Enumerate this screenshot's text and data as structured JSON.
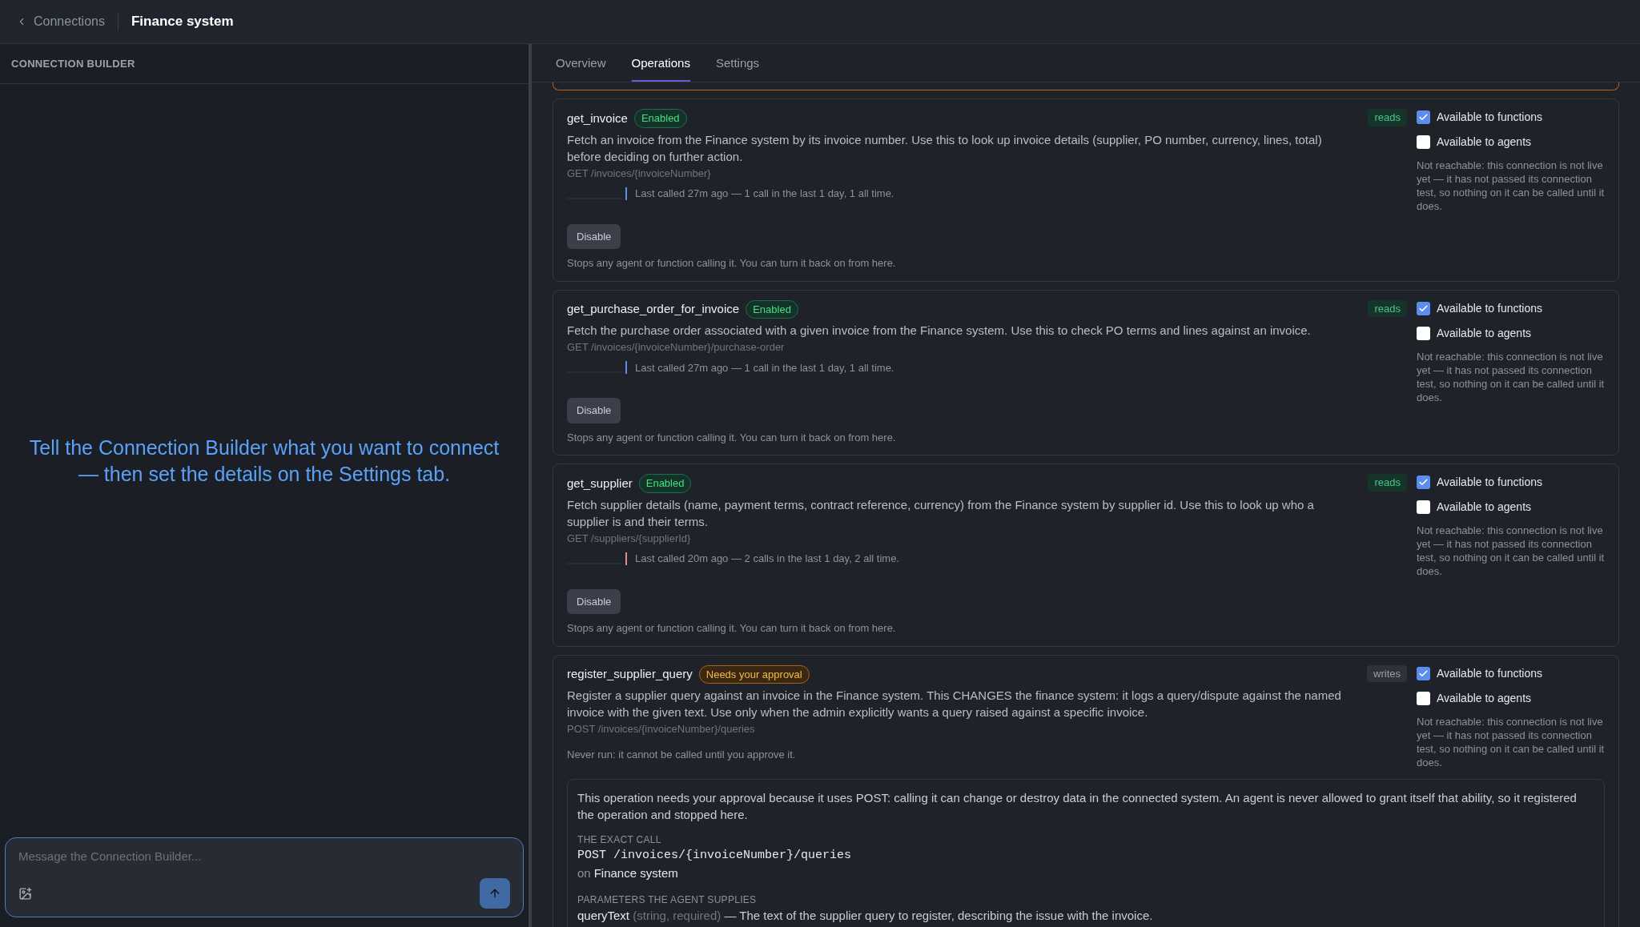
{
  "header": {
    "back_label": "Connections",
    "title": "Finance system"
  },
  "builder": {
    "title": "CONNECTION BUILDER",
    "prompt": "Tell the Connection Builder what you want to connect — then set the details on the Settings tab.",
    "input": {
      "placeholder": "Message the Connection Builder..."
    }
  },
  "tabs": [
    {
      "label": "Overview",
      "selected": false
    },
    {
      "label": "Operations",
      "selected": true
    },
    {
      "label": "Settings",
      "selected": false
    }
  ],
  "operations": [
    {
      "name": "get_invoice",
      "status": {
        "kind": "enabled",
        "label": "Enabled"
      },
      "access": {
        "kind": "reads",
        "label": "reads"
      },
      "description": "Fetch an invoice from the Finance system by its invoice number. Use this to look up invoice details (supplier, PO number, currency, lines, total) before deciding on further action.",
      "endpoint": "GET /invoices/{invoiceNumber}",
      "activity": {
        "text": "Last called 27m ago — 1 call in the last 1 day, 1 all time.",
        "color": "#5b8def"
      },
      "action": {
        "label": "Disable",
        "note": "Stops any agent or function calling it. You can turn it back on from here."
      },
      "availability": [
        {
          "label": "Available to functions",
          "checked": true
        },
        {
          "label": "Available to agents",
          "checked": false
        }
      ],
      "reach_note": "Not reachable: this connection is not live yet — it has not passed its connection test, so nothing on it can be called until it does."
    },
    {
      "name": "get_purchase_order_for_invoice",
      "status": {
        "kind": "enabled",
        "label": "Enabled"
      },
      "access": {
        "kind": "reads",
        "label": "reads"
      },
      "description": "Fetch the purchase order associated with a given invoice from the Finance system. Use this to check PO terms and lines against an invoice.",
      "endpoint": "GET /invoices/{invoiceNumber}/purchase-order",
      "activity": {
        "text": "Last called 27m ago — 1 call in the last 1 day, 1 all time.",
        "color": "#5b8def"
      },
      "action": {
        "label": "Disable",
        "note": "Stops any agent or function calling it. You can turn it back on from here."
      },
      "availability": [
        {
          "label": "Available to functions",
          "checked": true
        },
        {
          "label": "Available to agents",
          "checked": false
        }
      ],
      "reach_note": "Not reachable: this connection is not live yet — it has not passed its connection test, so nothing on it can be called until it does."
    },
    {
      "name": "get_supplier",
      "status": {
        "kind": "enabled",
        "label": "Enabled"
      },
      "access": {
        "kind": "reads",
        "label": "reads"
      },
      "description": "Fetch supplier details (name, payment terms, contract reference, currency) from the Finance system by supplier id. Use this to look up who a supplier is and their terms.",
      "endpoint": "GET /suppliers/{supplierId}",
      "activity": {
        "text": "Last called 20m ago — 2 calls in the last 1 day, 2 all time.",
        "color": "#e58a8a"
      },
      "action": {
        "label": "Disable",
        "note": "Stops any agent or function calling it. You can turn it back on from here."
      },
      "availability": [
        {
          "label": "Available to functions",
          "checked": true
        },
        {
          "label": "Available to agents",
          "checked": false
        }
      ],
      "reach_note": "Not reachable: this connection is not live yet — it has not passed its connection test, so nothing on it can be called until it does."
    },
    {
      "name": "register_supplier_query",
      "status": {
        "kind": "approval",
        "label": "Needs your approval"
      },
      "access": {
        "kind": "writes",
        "label": "writes"
      },
      "description": "Register a supplier query against an invoice in the Finance system. This CHANGES the finance system: it logs a query/dispute against the named invoice with the given text. Use only when the admin explicitly wants a query raised against a specific invoice.",
      "endpoint": "POST /invoices/{invoiceNumber}/queries",
      "never_run": "Never run: it cannot be called until you approve it.",
      "availability": [
        {
          "label": "Available to functions",
          "checked": true
        },
        {
          "label": "Available to agents",
          "checked": false
        }
      ],
      "reach_note": "Not reachable: this connection is not live yet — it has not passed its connection test, so nothing on it can be called until it does.",
      "approval": {
        "intro": "This operation needs your approval because it uses POST: calling it can change or destroy data in the connected system. An agent is never allowed to grant itself that ability, so it registered the operation and stopped here.",
        "call_heading": "THE EXACT CALL",
        "call": "POST /invoices/{invoiceNumber}/queries",
        "on_prefix": "on",
        "on_target": "Finance system",
        "params_heading": "PARAMETERS THE AGENT SUPPLIES",
        "params": [
          {
            "name": "queryText",
            "meta": "(string, required)",
            "description": "— The text of the supplier query to register, describing the issue with the invoice."
          }
        ]
      }
    }
  ]
}
